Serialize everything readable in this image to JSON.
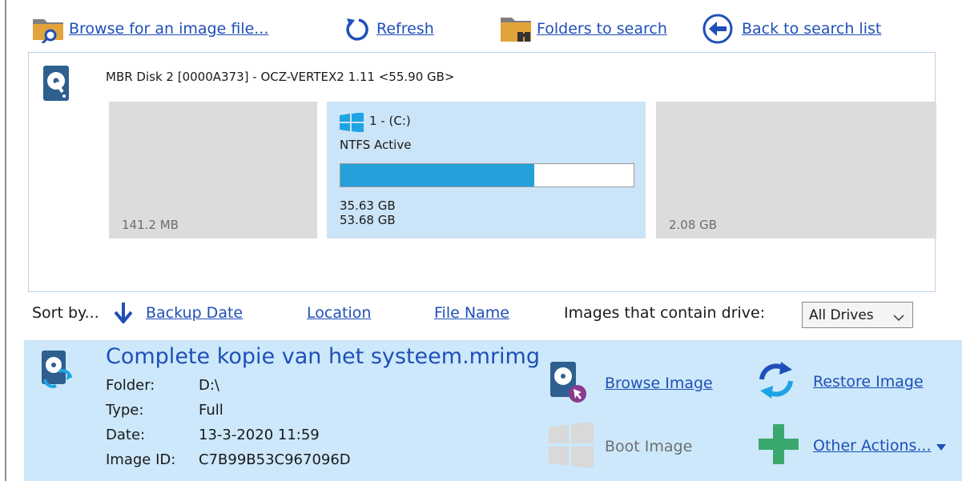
{
  "toolbar": {
    "browse_label": "Browse for an image file...",
    "refresh_label": "Refresh",
    "folders_label": "Folders to search",
    "back_label": "Back to search list"
  },
  "disk": {
    "title": "MBR Disk 2 [0000A373] - OCZ-VERTEX2 1.11  <55.90 GB>",
    "partitions": [
      {
        "size": "141.2 MB"
      },
      {
        "name": "1 - (C:)",
        "fs": "NTFS Active",
        "used": "35.63 GB",
        "total": "53.68 GB",
        "fill_fraction": 0.66,
        "selected": true
      },
      {
        "size": "2.08 GB"
      }
    ]
  },
  "sort": {
    "label": "Sort by...",
    "options": [
      "Backup Date",
      "Location",
      "File Name"
    ],
    "filter_label": "Images that contain drive:",
    "filter_value": "All Drives"
  },
  "image": {
    "title": "Complete kopie van het systeem.mrimg",
    "folder_label": "Folder:",
    "folder": "D:\\",
    "type_label": "Type:",
    "type": "Full",
    "date_label": "Date:",
    "date": "13-3-2020 11:59",
    "id_label": "Image ID:",
    "id": "C7B99B53C967096D"
  },
  "actions": {
    "browse_image": "Browse Image",
    "restore_image": "Restore Image",
    "boot_image": "Boot Image",
    "other_actions": "Other Actions..."
  },
  "colors": {
    "link": "#1f4fb8",
    "accent": "#26a0da",
    "selection": "#cce4f7",
    "entry_bg": "#cce8fa",
    "folder": "#e3a33b",
    "green_plus": "#3aa76d"
  },
  "icons": {
    "browse": "folder-search-icon",
    "refresh": "refresh-icon",
    "folders": "folder-binoculars-icon",
    "back": "back-arrow-icon",
    "disk": "hard-disk-icon",
    "windows": "windows-logo-icon",
    "sort": "down-arrow-icon",
    "image": "disk-image-icon",
    "browse_image": "browse-image-icon",
    "restore_image": "restore-icon",
    "boot_image": "windows-boot-icon",
    "other_actions": "plus-icon"
  }
}
